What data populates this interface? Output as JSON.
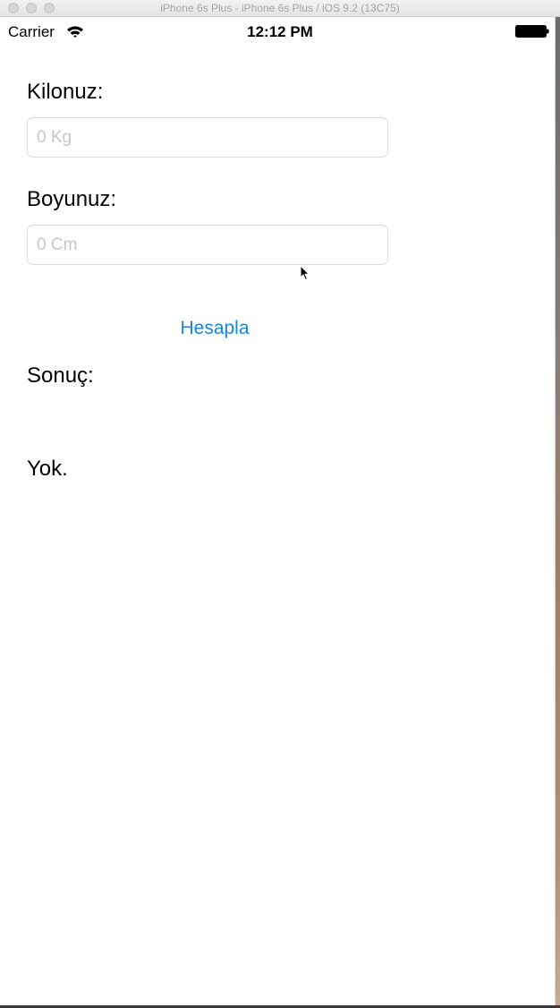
{
  "window": {
    "title": "iPhone 6s Plus - iPhone 6s Plus / iOS 9.2 (13C75)"
  },
  "status_bar": {
    "carrier": "Carrier",
    "time": "12:12 PM",
    "icons": [
      "wifi-icon",
      "battery-icon"
    ]
  },
  "form": {
    "weight_label": "Kilonuz:",
    "weight_value": "",
    "weight_placeholder": "0 Kg",
    "height_label": "Boyunuz:",
    "height_value": "",
    "height_placeholder": "0 Cm",
    "calculate_button": "Hesapla"
  },
  "result": {
    "label": "Sonuç:",
    "value": "Yok."
  },
  "colors": {
    "accent": "#1a84e3",
    "placeholder": "#c7c7cd",
    "field_border": "#d9d9d9"
  }
}
